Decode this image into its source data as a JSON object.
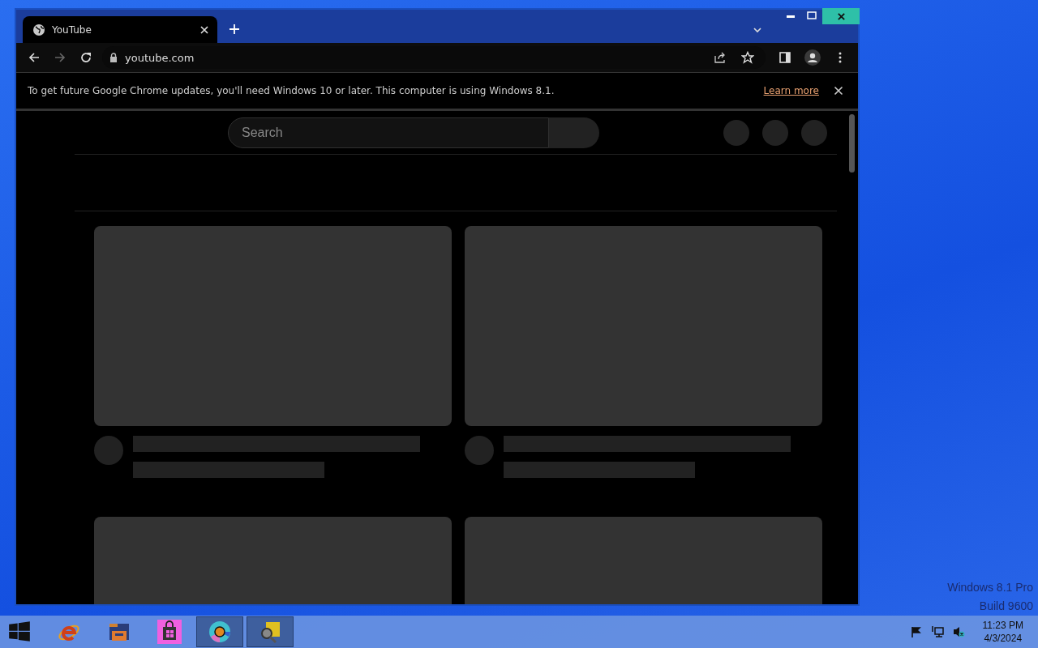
{
  "browser": {
    "tab": {
      "title": "YouTube",
      "selected": true
    },
    "address": "youtube.com",
    "infobar": {
      "message": "To get future Google Chrome updates, you'll need Windows 10 or later. This computer is using Windows 8.1.",
      "link": "Learn more"
    },
    "page": {
      "search_placeholder": "Search"
    }
  },
  "watermark": [
    "Windows 8.1 Pro",
    "Build 9600"
  ],
  "taskbar": {
    "apps": [
      {
        "kind": "ie",
        "running": false
      },
      {
        "kind": "explorer",
        "running": false
      },
      {
        "kind": "store",
        "running": false
      },
      {
        "kind": "chrome",
        "running": true
      },
      {
        "kind": "tool",
        "running": true
      }
    ]
  },
  "clock": {
    "time": "11:23 PM",
    "date": "4/3/2024"
  }
}
